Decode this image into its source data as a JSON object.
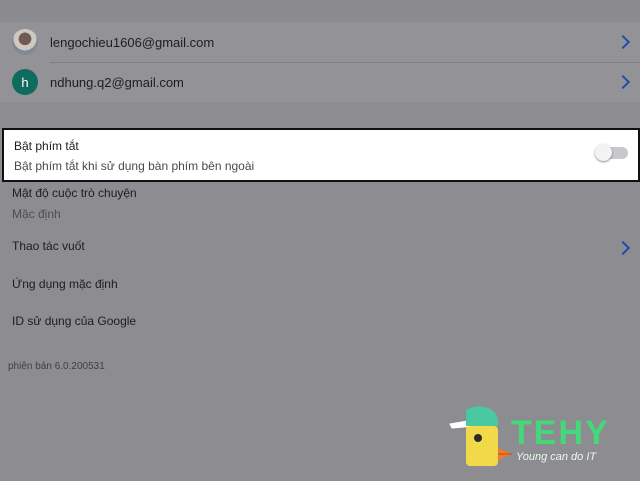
{
  "accounts": [
    {
      "email": "lengochieu1606@gmail.com",
      "avatar_type": "photo"
    },
    {
      "email": "ndhung.q2@gmail.com",
      "avatar_letter": "h",
      "avatar_color": "#0e6b5e"
    }
  ],
  "shortcut_setting": {
    "title": "Bật phím tắt",
    "subtitle": "Bật phím tắt khi sử dụng bàn phím bên ngoài",
    "enabled": false
  },
  "settings": {
    "density": {
      "label": "Mật độ cuộc trò chuyện",
      "value": "Mặc định"
    },
    "swipe": {
      "label": "Thao tác vuốt"
    },
    "default_apps": {
      "label": "Ứng dụng mặc định"
    },
    "google_id": {
      "label": "ID sử dụng của Google"
    }
  },
  "version": "phiên bản 6.0.200531",
  "watermark": {
    "brand": "TEHY",
    "tagline": "Young can do IT"
  },
  "colors": {
    "accent": "#1f4fa8",
    "logo_green": "#45d87a"
  }
}
